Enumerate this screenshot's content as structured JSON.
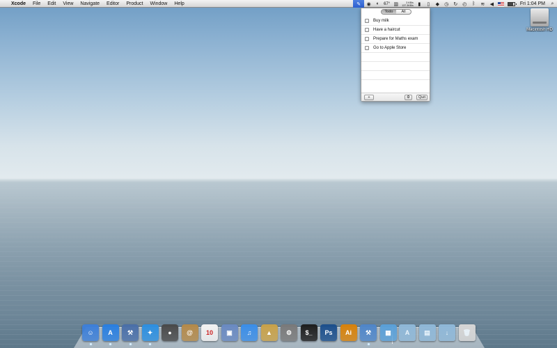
{
  "menubar": {
    "apple_glyph": "",
    "app_name": "Xcode",
    "menus": [
      "File",
      "Edit",
      "View",
      "Navigate",
      "Editor",
      "Product",
      "Window",
      "Help"
    ],
    "status": {
      "temperature": "67°",
      "network_up": "3 KB/s",
      "network_down": "137.3KB/s",
      "battery_level": 0.85,
      "clock": "Fri 1:04 PM"
    }
  },
  "desktop": {
    "hard_drive_label": "Macintosh HD"
  },
  "todo_popover": {
    "tabs": [
      "Todo",
      "All"
    ],
    "selected_tab": "Todo",
    "tasks": [
      "Buy milk",
      "Have a haircut",
      "Prepare for Maths exam",
      "Go to Apple Store"
    ],
    "footer": {
      "add_button": "+",
      "settings_icon": "gear-icon",
      "quit_button": "Quit"
    }
  },
  "dock": {
    "apps": [
      {
        "name": "finder",
        "color": "#3d7fd8",
        "glyph": "☺",
        "running": true
      },
      {
        "name": "app-store",
        "color": "#2a7fe0",
        "glyph": "A",
        "running": true
      },
      {
        "name": "xcode-instruments",
        "color": "#4a6fa8",
        "glyph": "⚒",
        "running": true
      },
      {
        "name": "safari",
        "color": "#2d8fe0",
        "glyph": "✦",
        "running": true
      },
      {
        "name": "facetime",
        "color": "#4a4a4a",
        "glyph": "●",
        "running": false
      },
      {
        "name": "address-book",
        "color": "#b48a4a",
        "glyph": "@",
        "running": false
      },
      {
        "name": "ical",
        "color": "#f2f2f2",
        "glyph": "10",
        "running": false
      },
      {
        "name": "preview",
        "color": "#6a8ac2",
        "glyph": "▣",
        "running": false
      },
      {
        "name": "itunes",
        "color": "#3b8ee8",
        "glyph": "♫",
        "running": false
      },
      {
        "name": "iphoto",
        "color": "#c9a24a",
        "glyph": "▲",
        "running": false
      },
      {
        "name": "system-preferences",
        "color": "#7a7a7a",
        "glyph": "⚙",
        "running": false
      },
      {
        "name": "terminal",
        "color": "#1e1e1e",
        "glyph": "$_",
        "running": false
      },
      {
        "name": "photoshop",
        "color": "#1c4f8c",
        "glyph": "Ps",
        "running": false
      },
      {
        "name": "illustrator",
        "color": "#d8820a",
        "glyph": "Ai",
        "running": false
      },
      {
        "name": "xcode",
        "color": "#4f86c9",
        "glyph": "⚒",
        "running": true
      },
      {
        "name": "simulator",
        "color": "#5aa0d8",
        "glyph": "▦",
        "running": false
      }
    ],
    "stacks": [
      {
        "name": "applications-folder",
        "color": "#8fb8d8",
        "glyph": "A"
      },
      {
        "name": "documents-folder",
        "color": "#8fb8d8",
        "glyph": "▤"
      },
      {
        "name": "downloads-folder",
        "color": "#8fb8d8",
        "glyph": "↓"
      },
      {
        "name": "trash",
        "color": "#d6d6d6",
        "glyph": "🗑"
      }
    ]
  }
}
